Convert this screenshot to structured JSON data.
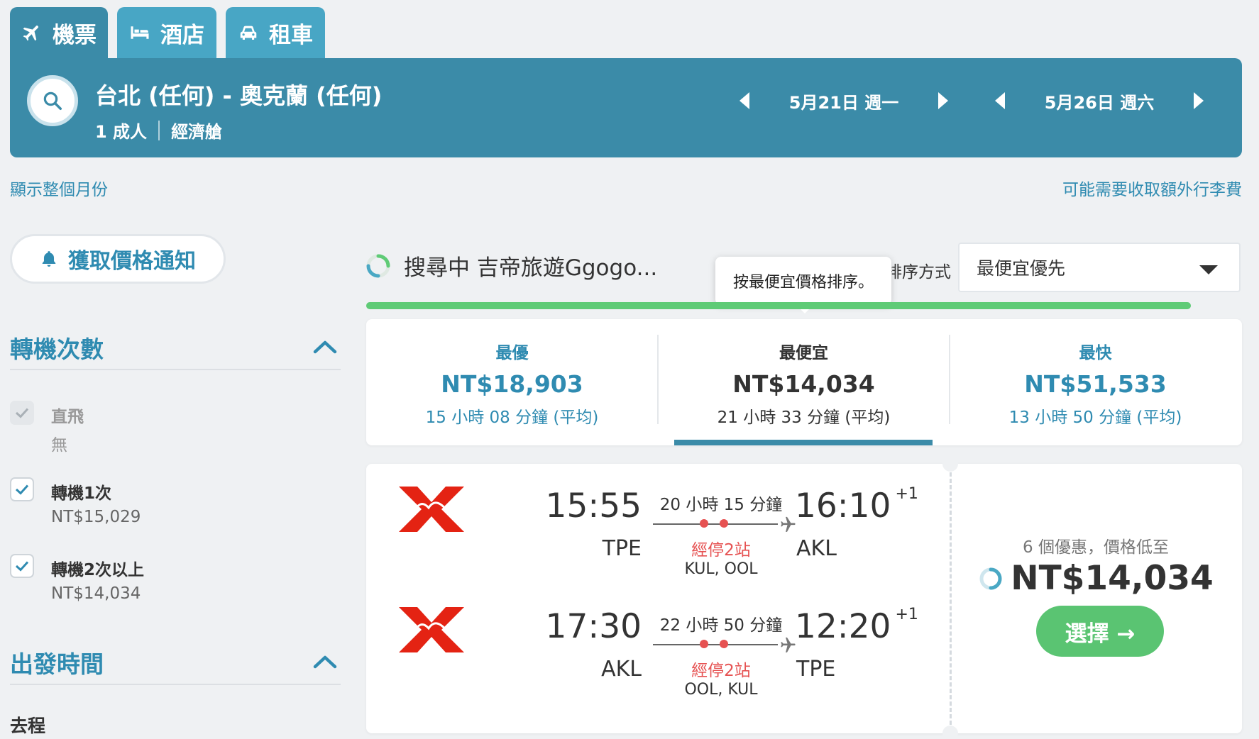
{
  "tabs": [
    {
      "label": "機票",
      "icon": "plane-icon",
      "active": true
    },
    {
      "label": "酒店",
      "icon": "bed-icon",
      "active": false
    },
    {
      "label": "租車",
      "icon": "car-icon",
      "active": false
    }
  ],
  "search": {
    "route": "台北 (任何) - 奧克蘭 (任何)",
    "passengers": "1 成人",
    "cabin": "經濟艙",
    "depart_date": "5月21日 週一",
    "return_date": "5月26日 週六"
  },
  "links": {
    "show_month": "顯示整個月份",
    "baggage_fee": "可能需要收取額外行李費"
  },
  "sidebar": {
    "price_alert": "獲取價格通知",
    "stops_title": "轉機次數",
    "stops": [
      {
        "label": "直飛",
        "sub": "無",
        "checked": true,
        "disabled": true
      },
      {
        "label": "轉機1次",
        "sub": "NT$15,029",
        "checked": true,
        "disabled": false
      },
      {
        "label": "轉機2次以上",
        "sub": "NT$14,034",
        "checked": true,
        "disabled": false
      }
    ],
    "depart_title": "出發時間",
    "outbound_label": "去程"
  },
  "status": {
    "loading_text": "搜尋中 吉帝旅遊Ggogo...",
    "progress": 1.0,
    "sort_label": "排序方式",
    "sort_value": "最便宜優先",
    "tooltip": "按最便宜價格排序。"
  },
  "sort_cards": [
    {
      "label": "最優",
      "price": "NT$18,903",
      "duration": "15 小時 08 分鐘 (平均)"
    },
    {
      "label": "最便宜",
      "price": "NT$14,034",
      "duration": "21 小時 33 分鐘 (平均)"
    },
    {
      "label": "最快",
      "price": "NT$51,533",
      "duration": "13 小時 50 分鐘 (平均)"
    }
  ],
  "result": {
    "legs": [
      {
        "dep_time": "15:55",
        "dep_airport": "TPE",
        "duration": "20 小時 15 分鐘",
        "stops": "經停2站",
        "via": "KUL, OOL",
        "arr_time": "16:10",
        "day_offset": "+1",
        "arr_airport": "AKL"
      },
      {
        "dep_time": "17:30",
        "dep_airport": "AKL",
        "duration": "22 小時 50 分鐘",
        "stops": "經停2站",
        "via": "OOL, KUL",
        "arr_time": "12:20",
        "day_offset": "+1",
        "arr_airport": "TPE"
      }
    ],
    "deals_text": "6 個優惠，價格低至",
    "price": "NT$14,034",
    "select_label": "選擇 →"
  },
  "colors": {
    "brand_blue": "#3b8ba8",
    "link_blue": "#2f8bb1",
    "progress_green": "#5fcb76",
    "stops_red": "#e65252",
    "select_green": "#5ac472"
  }
}
